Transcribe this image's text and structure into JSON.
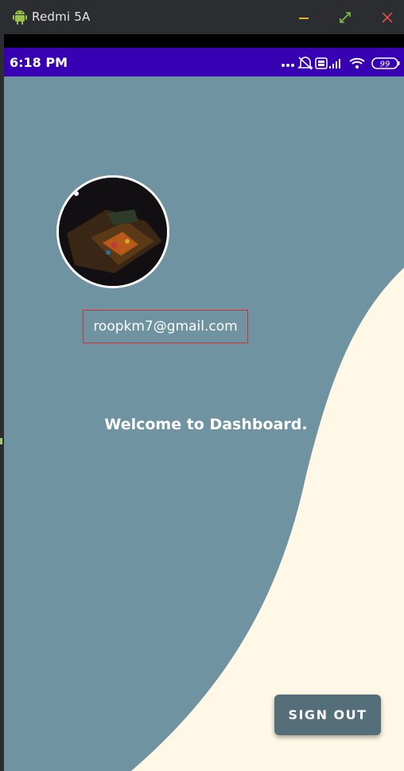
{
  "window": {
    "title": "Redmi 5A",
    "buttons": [
      "minimize",
      "maximize",
      "close"
    ]
  },
  "status_bar": {
    "time": "6:18 PM",
    "battery": "99",
    "icons": [
      "more-dots-icon",
      "notifications-off-icon",
      "volte-icon",
      "signal-icon",
      "wifi-icon",
      "battery-icon"
    ]
  },
  "dashboard": {
    "email": "roopkm7@gmail.com",
    "welcome": "Welcome to Dashboard.",
    "sign_out_label": "SIGN OUT"
  },
  "colors": {
    "status_bar": "#3700b3",
    "background": "#6f93a1",
    "wave": "#fff8e6",
    "button": "#546e7a",
    "email_border": "#d32f2f"
  }
}
